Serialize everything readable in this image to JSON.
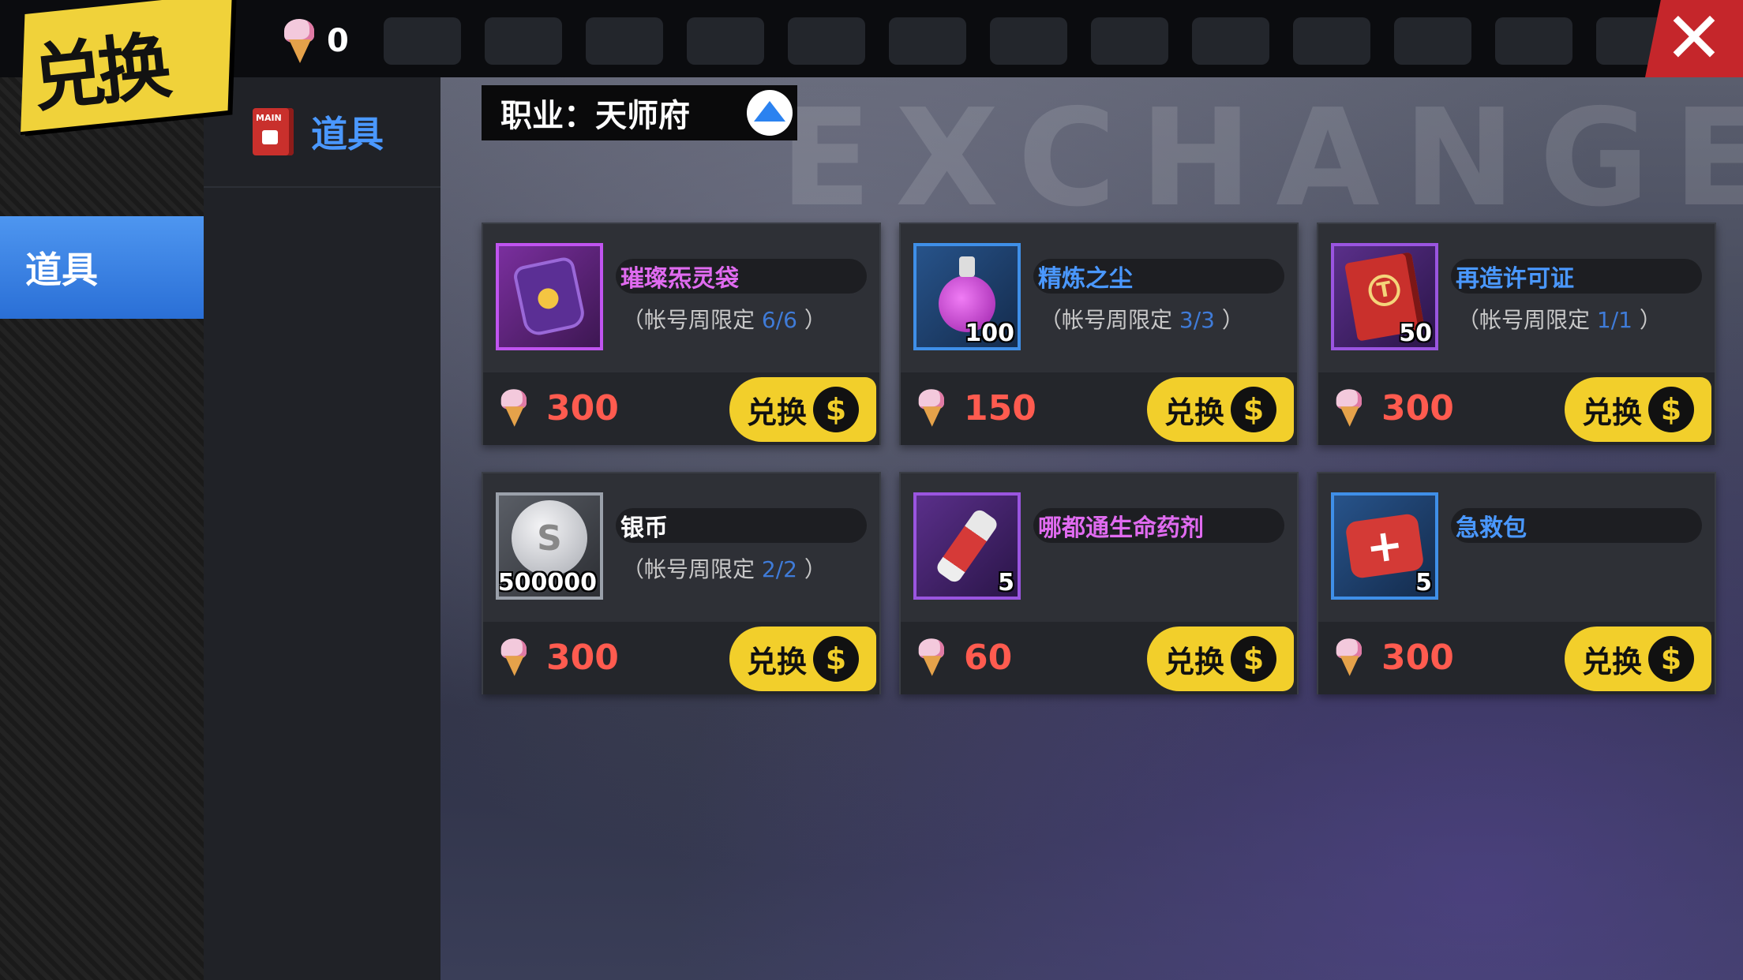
{
  "header": {
    "title": "兑换",
    "currency_value": "0",
    "currency_icon": "ice-cream-icon",
    "close_icon": "close-icon"
  },
  "left_nav": {
    "items": [
      {
        "label": "道具",
        "active": true
      }
    ]
  },
  "sub_nav": {
    "items": [
      {
        "label": "道具",
        "icon": "main-book-icon"
      }
    ]
  },
  "main": {
    "background_watermark": "EXCHANGE",
    "class_filter": {
      "label": "职业：",
      "value": "天师府"
    },
    "exchange_button_label": "兑换",
    "coin_glyph": "$",
    "items": [
      {
        "name": "璀璨炁灵袋",
        "name_color": "#e06bf0",
        "limit_prefix": "（帐号周限定",
        "limit": "6/6",
        "limit_suffix": "）",
        "quantity": "",
        "price": "300",
        "icon": "pouch-icon",
        "rarity": "purple"
      },
      {
        "name": "精炼之尘",
        "name_color": "#4a98ff",
        "limit_prefix": "（帐号周限定",
        "limit": "3/3",
        "limit_suffix": "）",
        "quantity": "100",
        "price": "150",
        "icon": "dust-flask-icon",
        "rarity": "blue"
      },
      {
        "name": "再造许可证",
        "name_color": "#4a98ff",
        "limit_prefix": "（帐号周限定",
        "limit": "1/1",
        "limit_suffix": "）",
        "quantity": "50",
        "price": "300",
        "icon": "license-book-icon",
        "rarity": "violet"
      },
      {
        "name": "银币",
        "name_color": "#ffffff",
        "limit_prefix": "（帐号周限定",
        "limit": "2/2",
        "limit_suffix": "）",
        "quantity": "500000",
        "price": "300",
        "icon": "silver-coin-icon",
        "rarity": "gray"
      },
      {
        "name": "哪都通生命药剂",
        "name_color": "#e06bf0",
        "limit_prefix": "",
        "limit": "",
        "limit_suffix": "",
        "quantity": "5",
        "price": "60",
        "icon": "life-potion-icon",
        "rarity": "violet"
      },
      {
        "name": "急救包",
        "name_color": "#4a98ff",
        "limit_prefix": "",
        "limit": "",
        "limit_suffix": "",
        "quantity": "5",
        "price": "300",
        "icon": "first-aid-kit-icon",
        "rarity": "blue"
      }
    ]
  }
}
